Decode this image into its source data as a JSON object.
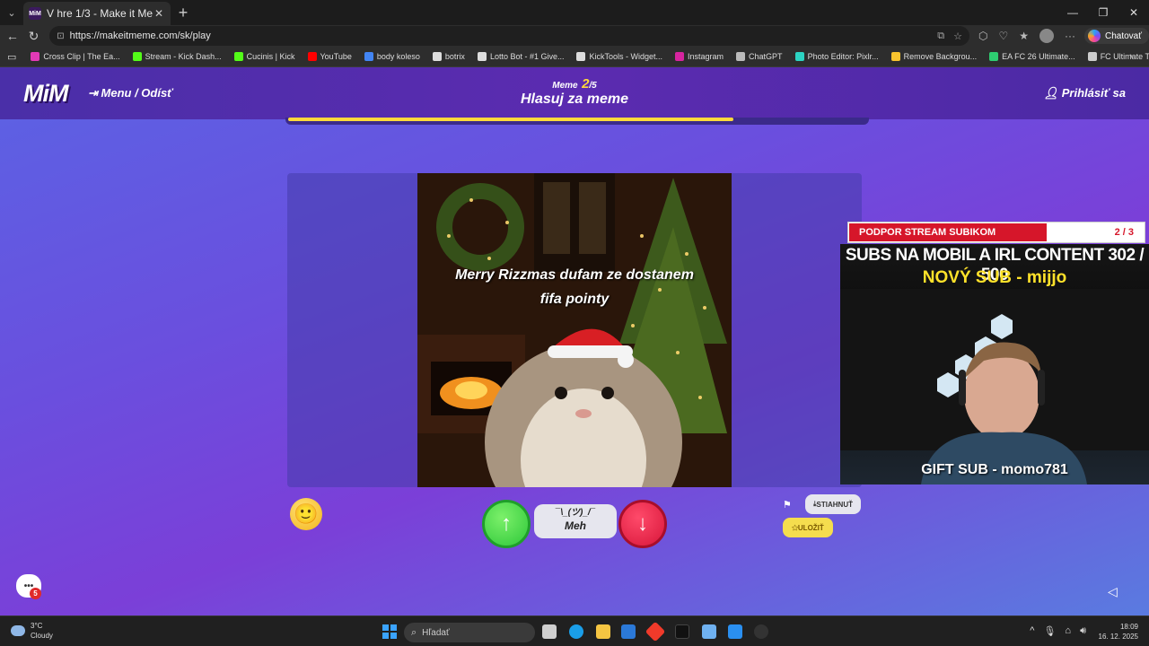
{
  "browser": {
    "tab_title": "V hre 1/3 - Make it Meme",
    "tab_favicon": "MiM",
    "url": "https://makeitmeme.com/sk/play",
    "copilot_label": "Chatovať",
    "bookmarks": [
      {
        "label": "Cross Clip | The Ea...",
        "color": "#e23ab6"
      },
      {
        "label": "Stream - Kick Dash...",
        "color": "#53fc18"
      },
      {
        "label": "Cucinis | Kick",
        "color": "#53fc18"
      },
      {
        "label": "YouTube",
        "color": "#ff0000"
      },
      {
        "label": "body koleso",
        "color": "#4285f4"
      },
      {
        "label": "botrix",
        "color": "#dddddd"
      },
      {
        "label": "Lotto Bot - #1 Give...",
        "color": "#dddddd"
      },
      {
        "label": "KickTools - Widget...",
        "color": "#dddddd"
      },
      {
        "label": "Instagram",
        "color": "#d6249f"
      },
      {
        "label": "ChatGPT",
        "color": "#bbbbbb"
      },
      {
        "label": "Photo Editor: Pixlr...",
        "color": "#2cd3c2"
      },
      {
        "label": "Remove Backgrou...",
        "color": "#f7c32e"
      },
      {
        "label": "EA FC 26 Ultimate...",
        "color": "#2ecc71"
      },
      {
        "label": "FC Ultimate Team...",
        "color": "#cccccc"
      }
    ]
  },
  "game": {
    "logo": "MiM",
    "menu_label": "Menu / Odísť",
    "round_prefix": "Meme",
    "round_current": "2",
    "round_total": "/5",
    "round_title": "Hlasuj za meme",
    "login_label": "Prihlásiť sa",
    "progress": 0.77,
    "meme_caption_line1": "Merry Rizzmas dufam ze dostanem",
    "meme_caption_line2": "fifa pointy",
    "meh_face": "¯\\_(ツ)_/¯",
    "meh_label": "Meh",
    "download_label": "STIAHNUŤ",
    "save_label": "ULOŽIŤ",
    "chat_badge": "5"
  },
  "stream_overlay": {
    "goal_label": "PODPOR STREAM SUBIKOM",
    "goal_count": "2 / 3",
    "goal_progress": 0.67,
    "subs_line": "SUBS NA MOBIL A IRL CONTENT  302 / 500",
    "new_sub": "NOVÝ SUB - mijjo",
    "gift_sub": "GIFT SUB - momo781"
  },
  "taskbar": {
    "temp": "3°C",
    "weather": "Cloudy",
    "search_placeholder": "Hľadať",
    "time": "18:09",
    "date": "16. 12. 2025"
  }
}
